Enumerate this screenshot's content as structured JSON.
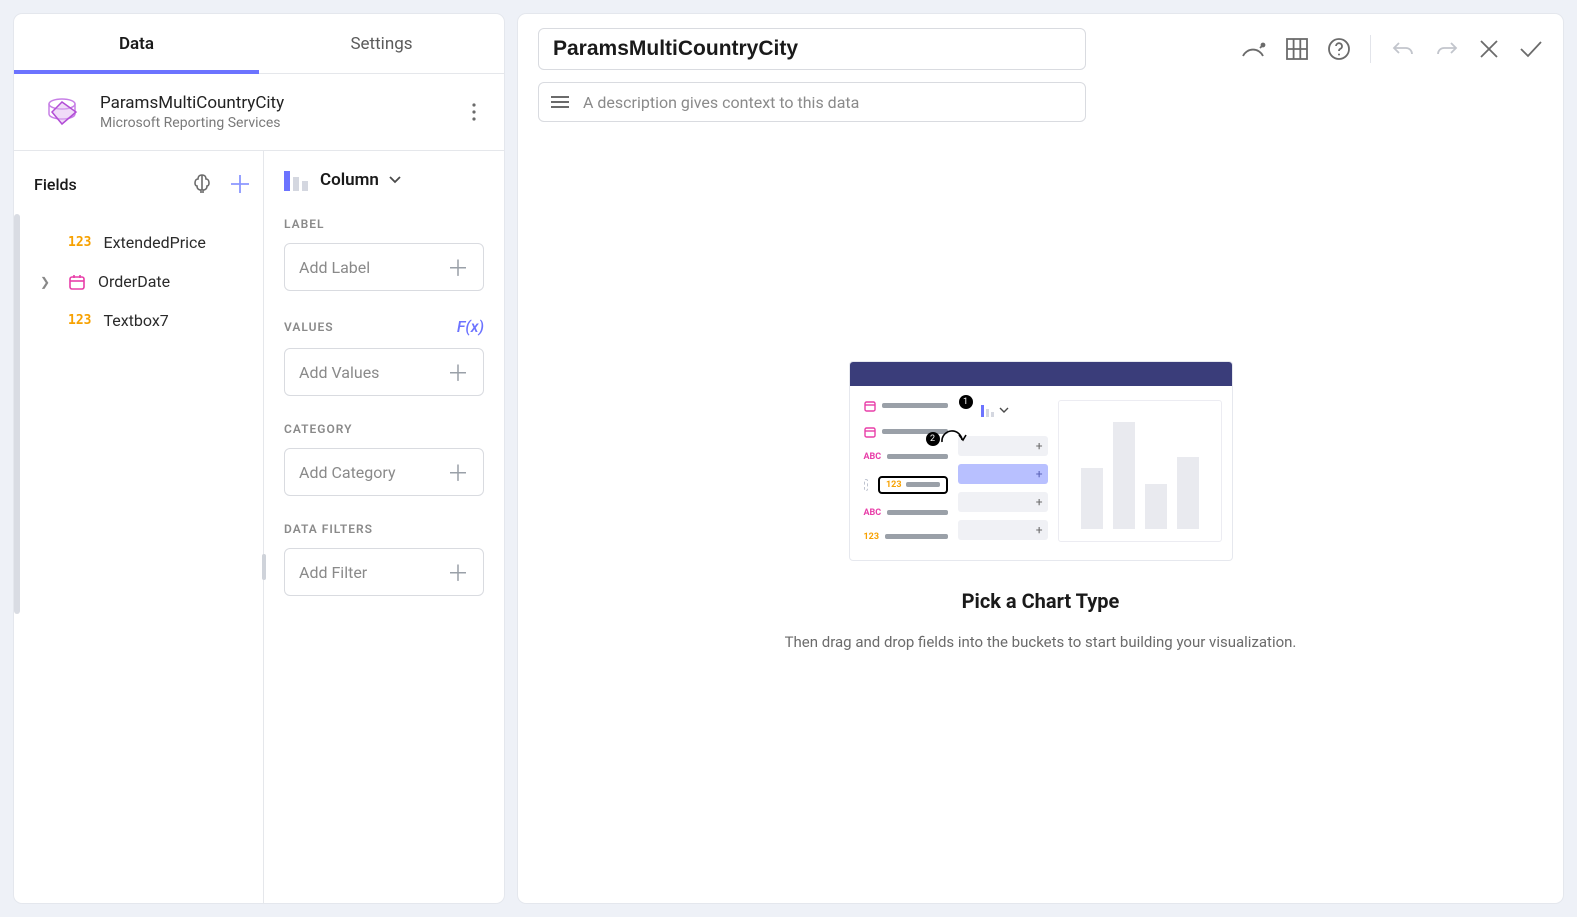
{
  "tabs": {
    "data": "Data",
    "settings": "Settings"
  },
  "datasource": {
    "name": "ParamsMultiCountryCity",
    "subtitle": "Microsoft Reporting Services"
  },
  "fields": {
    "title": "Fields",
    "items": [
      {
        "type": "123",
        "label": "ExtendedPrice",
        "expandable": false
      },
      {
        "type": "date",
        "label": "OrderDate",
        "expandable": true
      },
      {
        "type": "123",
        "label": "Textbox7",
        "expandable": false
      }
    ]
  },
  "chartType": "Column",
  "buckets": {
    "label": {
      "title": "LABEL",
      "placeholder": "Add Label"
    },
    "values": {
      "title": "VALUES",
      "placeholder": "Add Values",
      "fx": "F(x)"
    },
    "category": {
      "title": "CATEGORY",
      "placeholder": "Add Category"
    },
    "filters": {
      "title": "DATA FILTERS",
      "placeholder": "Add Filter"
    }
  },
  "header": {
    "title": "ParamsMultiCountryCity",
    "descriptionPlaceholder": "A description gives context to this data"
  },
  "empty": {
    "title": "Pick a Chart Type",
    "subtitle": "Then drag and drop fields into the buckets to start building your visualization."
  }
}
